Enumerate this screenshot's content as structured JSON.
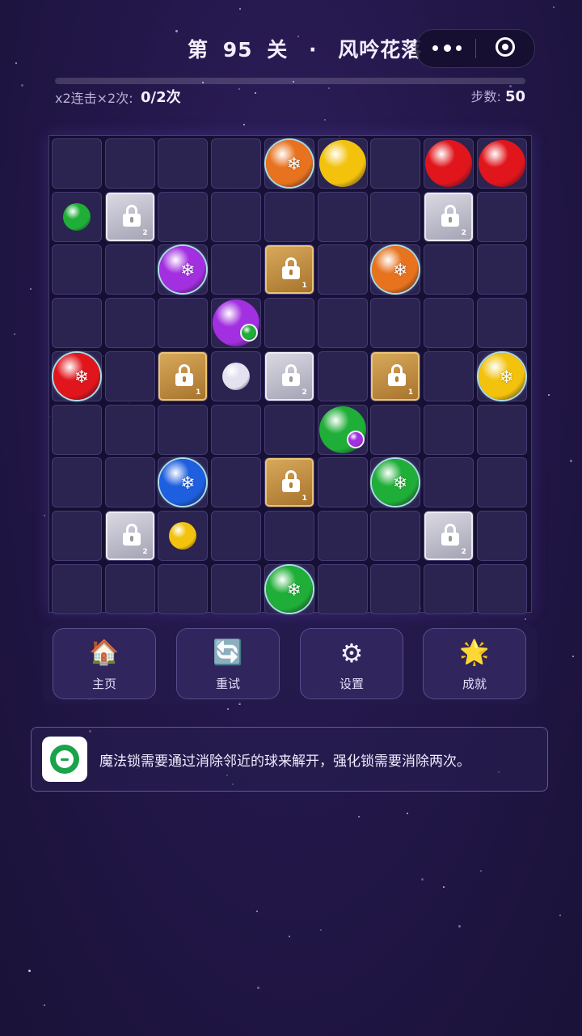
{
  "header": {
    "title_parts": [
      "第",
      "95",
      "关",
      "·",
      "风吟花落"
    ],
    "menu_icon": "more-dots-icon",
    "close_icon": "target-circle-icon"
  },
  "status": {
    "task_label": "x2连击×2次:",
    "task_value": "0/2次",
    "task_progress": 0,
    "steps_label": "步数:",
    "steps_value": "50"
  },
  "board": {
    "cols": 9,
    "rows": 9,
    "pieces": [
      {
        "row": 0,
        "col": 4,
        "kind": "ball",
        "color": "orange",
        "frozen": true
      },
      {
        "row": 0,
        "col": 5,
        "kind": "ball",
        "color": "yellow"
      },
      {
        "row": 0,
        "col": 7,
        "kind": "ball",
        "color": "red"
      },
      {
        "row": 0,
        "col": 8,
        "kind": "ball",
        "color": "red"
      },
      {
        "row": 1,
        "col": 0,
        "kind": "small",
        "color": "green"
      },
      {
        "row": 1,
        "col": 1,
        "kind": "lock",
        "lock": "silver",
        "count": "2"
      },
      {
        "row": 1,
        "col": 7,
        "kind": "lock",
        "lock": "silver",
        "count": "2"
      },
      {
        "row": 2,
        "col": 2,
        "kind": "ball",
        "color": "purple",
        "frozen": true
      },
      {
        "row": 2,
        "col": 4,
        "kind": "lock",
        "lock": "gold",
        "count": "1"
      },
      {
        "row": 2,
        "col": 6,
        "kind": "ball",
        "color": "orange",
        "frozen": true
      },
      {
        "row": 3,
        "col": 3,
        "kind": "ball",
        "color": "purple",
        "gem": "green"
      },
      {
        "row": 4,
        "col": 0,
        "kind": "ball",
        "color": "red",
        "frozen": true
      },
      {
        "row": 4,
        "col": 2,
        "kind": "lock",
        "lock": "gold",
        "count": "1"
      },
      {
        "row": 4,
        "col": 3,
        "kind": "small",
        "color": "white"
      },
      {
        "row": 4,
        "col": 4,
        "kind": "lock",
        "lock": "silver",
        "count": "2"
      },
      {
        "row": 4,
        "col": 6,
        "kind": "lock",
        "lock": "gold",
        "count": "1"
      },
      {
        "row": 4,
        "col": 8,
        "kind": "ball",
        "color": "yellow",
        "frozen": true
      },
      {
        "row": 5,
        "col": 5,
        "kind": "ball",
        "color": "green",
        "gem": "purple"
      },
      {
        "row": 6,
        "col": 2,
        "kind": "ball",
        "color": "blue",
        "frozen": true
      },
      {
        "row": 6,
        "col": 4,
        "kind": "lock",
        "lock": "gold",
        "count": "1"
      },
      {
        "row": 6,
        "col": 6,
        "kind": "ball",
        "color": "green",
        "frozen": true
      },
      {
        "row": 7,
        "col": 1,
        "kind": "lock",
        "lock": "silver",
        "count": "2"
      },
      {
        "row": 7,
        "col": 2,
        "kind": "small",
        "color": "yellow"
      },
      {
        "row": 7,
        "col": 7,
        "kind": "lock",
        "lock": "silver",
        "count": "2"
      },
      {
        "row": 8,
        "col": 4,
        "kind": "ball",
        "color": "green",
        "frozen": true
      }
    ]
  },
  "colors": {
    "red": "#e0161c",
    "orange": "#e8731f",
    "yellow": "#f2c20d",
    "green": "#1fae37",
    "blue": "#1e5fe0",
    "purple": "#a22fe0",
    "white": "#e4e2f0",
    "accent": "#8d7bdc"
  },
  "controls": [
    {
      "id": "home",
      "label": "主页",
      "icon": "home-icon",
      "glyph": "🏠"
    },
    {
      "id": "retry",
      "label": "重试",
      "icon": "retry-icon",
      "glyph": "🔄"
    },
    {
      "id": "settings",
      "label": "设置",
      "icon": "gear-icon",
      "glyph": "⚙"
    },
    {
      "id": "achievements",
      "label": "成就",
      "icon": "star-icon",
      "glyph": "🌟"
    }
  ],
  "hint": {
    "icon": "wechat-chat-icon",
    "text": "魔法锁需要通过消除邻近的球来解开，强化锁需要消除两次。"
  }
}
